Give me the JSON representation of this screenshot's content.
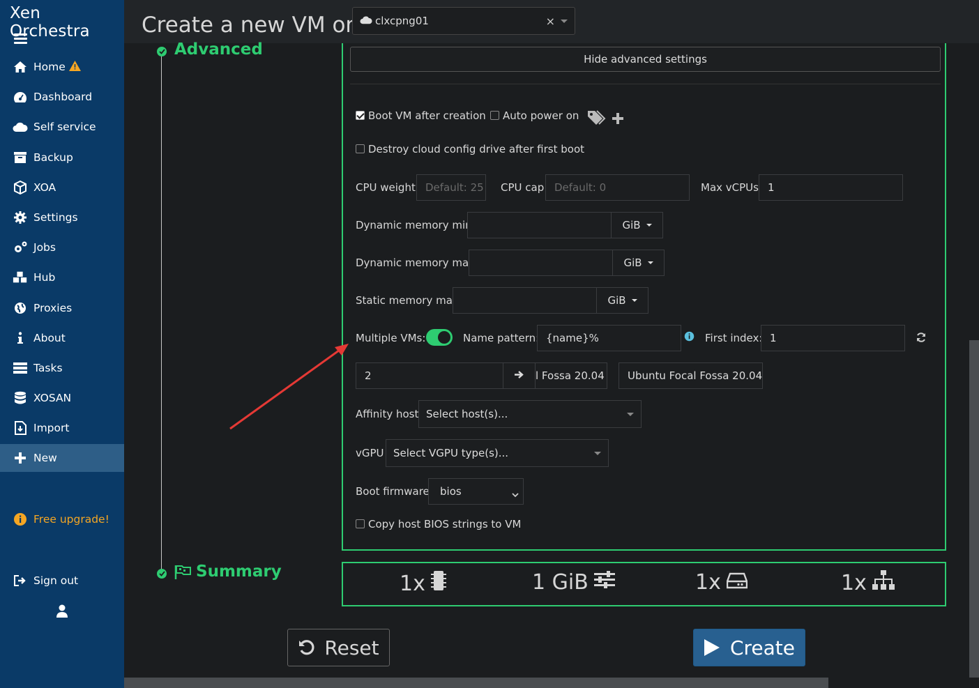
{
  "app": {
    "brand": "Xen Orchestra"
  },
  "sidebar": {
    "items": [
      {
        "label": "Home",
        "icon": "home-icon"
      },
      {
        "label": "Dashboard",
        "icon": "dashboard-icon"
      },
      {
        "label": "Self service",
        "icon": "cloud-icon"
      },
      {
        "label": "Backup",
        "icon": "archive-icon"
      },
      {
        "label": "XOA",
        "icon": "cube-icon"
      },
      {
        "label": "Settings",
        "icon": "gear-icon"
      },
      {
        "label": "Jobs",
        "icon": "gears-icon"
      },
      {
        "label": "Hub",
        "icon": "cubes-icon"
      },
      {
        "label": "Proxies",
        "icon": "globe-icon"
      },
      {
        "label": "About",
        "icon": "info-icon"
      },
      {
        "label": "Tasks",
        "icon": "tasks-icon"
      },
      {
        "label": "XOSAN",
        "icon": "database-icon"
      },
      {
        "label": "Import",
        "icon": "file-import-icon"
      },
      {
        "label": "New",
        "icon": "plus-icon"
      }
    ],
    "upgrade": "Free upgrade!",
    "sign_out": "Sign out"
  },
  "header": {
    "title": "Create a new VM on",
    "pool": "clxcpng01"
  },
  "steps": {
    "advanced": "Advanced",
    "summary": "Summary"
  },
  "advanced": {
    "hide_button": "Hide advanced settings",
    "boot_after_creation": "Boot VM after creation",
    "auto_power_on": "Auto power on",
    "destroy_cloud_config": "Destroy cloud config drive after first boot",
    "cpu_weight_label": "CPU weight",
    "cpu_weight_placeholder": "Default: 25",
    "cpu_cap_label": "CPU cap",
    "cpu_cap_placeholder": "Default: 0",
    "max_vcpus_label": "Max vCPUs",
    "max_vcpus_value": "1",
    "dyn_mem_min_label": "Dynamic memory min",
    "dyn_mem_max_label": "Dynamic memory max",
    "static_mem_max_label": "Static memory max",
    "unit": "GiB",
    "multiple_vms_label": "Multiple VMs:",
    "multiple_vms_enabled": true,
    "name_pattern_label": "Name pattern:",
    "name_pattern_value": "{name}%",
    "first_index_label": "First index:",
    "first_index_value": "1",
    "vm_count": "2",
    "vm_name_1": "l Fossa 20.04",
    "vm_name_2": "Ubuntu Focal Fossa 20.04.",
    "affinity_label": "Affinity host",
    "affinity_placeholder": "Select host(s)...",
    "vgpu_label": "vGPU",
    "vgpu_placeholder": "Select VGPU type(s)...",
    "boot_firmware_label": "Boot firmware",
    "boot_firmware_value": "bios",
    "copy_bios_label": "Copy host BIOS strings to VM"
  },
  "summary": {
    "cpus": "1x",
    "memory": "1 GiB",
    "disks": "1x",
    "networks": "1x"
  },
  "buttons": {
    "reset": "Reset",
    "create": "Create"
  },
  "colors": {
    "sidebar_bg": "#0a3a67",
    "accent_green": "#2ecc71",
    "create_blue": "#286090",
    "annotation_red": "#e53935"
  }
}
